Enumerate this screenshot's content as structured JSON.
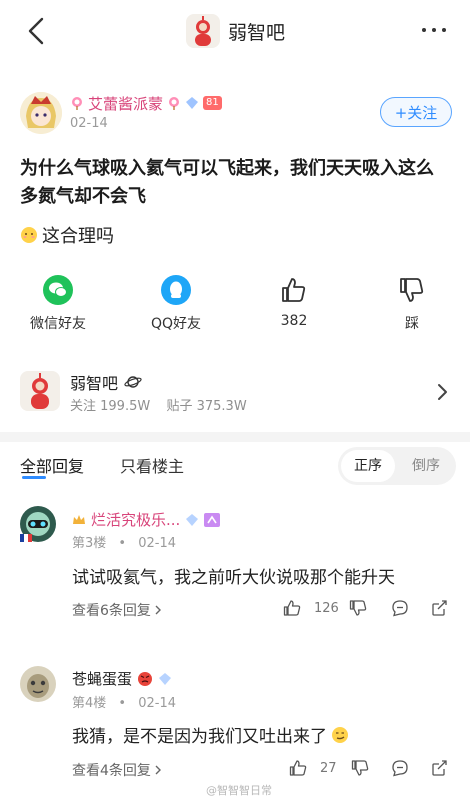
{
  "header": {
    "forum_name": "弱智吧"
  },
  "post": {
    "author": "艾蕾酱派蒙",
    "level": "81",
    "date": "02-14",
    "follow_label": "+关注",
    "title": "为什么气球吸入氦气可以飞起来，我们天天吸入这么多氮气却不会飞",
    "body": "这合理吗"
  },
  "actions": {
    "wechat": "微信好友",
    "qq": "QQ好友",
    "likes": "382",
    "dislike": "踩"
  },
  "forum_card": {
    "name": "弱智吧",
    "followers": "关注 199.5W",
    "posts": "贴子 375.3W"
  },
  "reply_tabs": {
    "all": "全部回复",
    "op_only": "只看楼主",
    "sort_asc": "正序",
    "sort_desc": "倒序"
  },
  "comments": [
    {
      "name": "烂活究极乐...",
      "floor": "第3楼",
      "dot": "•",
      "date": "02-14",
      "text": "试试吸氦气，我之前听大伙说吸那个能升天",
      "replies": "查看6条回复",
      "likes": "126"
    },
    {
      "name": "苍蝇蛋蛋",
      "floor": "第4楼",
      "dot": "•",
      "date": "02-14",
      "text": "我猜，是不是因为我们又吐出来了",
      "replies": "查看4条回复",
      "likes": "27"
    }
  ],
  "watermark": "@智智智日常",
  "colors": {
    "accent": "#2f8cff",
    "wechat": "#1fc25a",
    "qq": "#1ea6f7",
    "vip_name": "#d8447a"
  }
}
